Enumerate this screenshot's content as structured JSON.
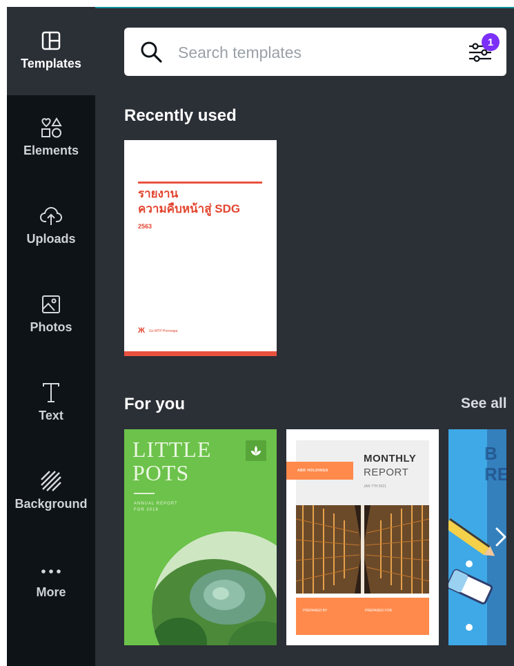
{
  "sidebar": {
    "items": [
      {
        "label": "Templates",
        "icon": "templates-icon",
        "active": true
      },
      {
        "label": "Elements",
        "icon": "elements-icon"
      },
      {
        "label": "Uploads",
        "icon": "upload-cloud-icon"
      },
      {
        "label": "Photos",
        "icon": "photo-icon"
      },
      {
        "label": "Text",
        "icon": "text-icon"
      },
      {
        "label": "Background",
        "icon": "background-pattern-icon"
      },
      {
        "label": "More",
        "icon": "more-dots-icon"
      }
    ]
  },
  "search": {
    "placeholder": "Search templates",
    "value": "",
    "filter_badge": "1"
  },
  "recently_used": {
    "title": "Recently used",
    "templates": [
      {
        "title_line1": "รายงาน",
        "title_line2": "ความคืบหน้าสู่ SDG",
        "year": "2563",
        "footer_text": "Go MTP Pornsapa"
      }
    ]
  },
  "for_you": {
    "title": "For you",
    "see_all": "See all",
    "templates": [
      {
        "title": "LITTLE POTS",
        "subtitle": "ANNUAL REPORT FOR 2019"
      },
      {
        "title_line1": "MONTHLY",
        "title_line2": "REPORT",
        "date": "JAN 7TH 2021",
        "tag": "ABD HOLDINGS",
        "footer_left": "PREPARED BY",
        "footer_right": "PREPARED FOR"
      },
      {
        "title": "B RE"
      }
    ]
  },
  "colors": {
    "sidebar_bg": "#0e1318",
    "panel_bg": "#2b2f36",
    "accent_badge": "#7b2ff7",
    "template_red": "#e2452f",
    "template_green": "#6cc24a",
    "template_orange": "#ff8a4c",
    "template_blue": "#3ea9e6"
  }
}
